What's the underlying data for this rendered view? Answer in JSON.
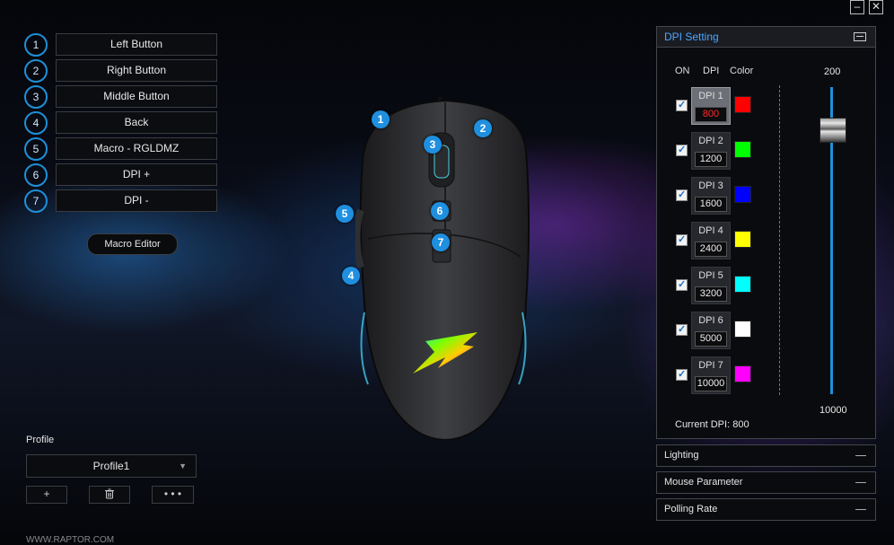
{
  "window": {
    "minimize_icon": "minimize-icon",
    "close_icon": "close-icon"
  },
  "buttons": [
    {
      "num": "1",
      "label": "Left Button"
    },
    {
      "num": "2",
      "label": "Right Button"
    },
    {
      "num": "3",
      "label": "Middle Button"
    },
    {
      "num": "4",
      "label": "Back"
    },
    {
      "num": "5",
      "label": "Macro - RGLDMZ"
    },
    {
      "num": "6",
      "label": "DPI +"
    },
    {
      "num": "7",
      "label": "DPI -"
    }
  ],
  "macro_editor": "Macro Editor",
  "profile": {
    "label": "Profile",
    "selected": "Profile1",
    "add": "+",
    "delete_icon": "trash-icon",
    "more": "• • •"
  },
  "footer_url": "WWW.RAPTOR.COM",
  "mouse_callouts": [
    "1",
    "2",
    "3",
    "4",
    "5",
    "6",
    "7"
  ],
  "dpi_setting": {
    "title": "DPI Setting",
    "col_on": "ON",
    "col_dpi": "DPI",
    "col_color": "Color",
    "slider_max_label": "200",
    "slider_min_label": "10000",
    "current_label": "Current DPI:",
    "current_value": "800",
    "levels": [
      {
        "name": "DPI 1",
        "value": "800",
        "color": "#ff0000",
        "on": true,
        "active": true
      },
      {
        "name": "DPI 2",
        "value": "1200",
        "color": "#00ff00",
        "on": true,
        "active": false
      },
      {
        "name": "DPI 3",
        "value": "1600",
        "color": "#0000ff",
        "on": true,
        "active": false
      },
      {
        "name": "DPI 4",
        "value": "2400",
        "color": "#ffff00",
        "on": true,
        "active": false
      },
      {
        "name": "DPI 5",
        "value": "3200",
        "color": "#00ffff",
        "on": true,
        "active": false
      },
      {
        "name": "DPI 6",
        "value": "5000",
        "color": "#ffffff",
        "on": true,
        "active": false
      },
      {
        "name": "DPI 7",
        "value": "10000",
        "color": "#ff00ff",
        "on": true,
        "active": false
      }
    ]
  },
  "sections": {
    "lighting": "Lighting",
    "mouse_parameter": "Mouse Parameter",
    "polling_rate": "Polling Rate"
  }
}
